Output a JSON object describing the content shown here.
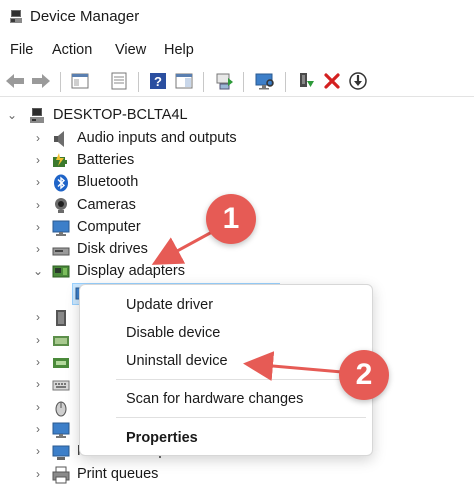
{
  "window": {
    "title": "Device Manager"
  },
  "menu": [
    {
      "id": "file",
      "label": "File"
    },
    {
      "id": "action",
      "label": "Action"
    },
    {
      "id": "view",
      "label": "View"
    },
    {
      "id": "help",
      "label": "Help"
    }
  ],
  "toolbar": [
    {
      "name": "back-icon"
    },
    {
      "name": "forward-icon"
    },
    {
      "name": "properties-icon"
    },
    {
      "name": "show-hide-console-tree-icon"
    },
    {
      "name": "help-icon"
    },
    {
      "name": "action-pane-icon"
    },
    {
      "name": "update-driver-icon"
    },
    {
      "name": "scan-hardware-icon"
    },
    {
      "name": "enable-device-icon"
    },
    {
      "name": "uninstall-icon"
    },
    {
      "name": "disable-device-icon"
    }
  ],
  "tree": {
    "root": "DESKTOP-BCLTA4L",
    "items": [
      {
        "label": "Audio inputs and outputs",
        "icon": "speaker-icon"
      },
      {
        "label": "Batteries",
        "icon": "battery-icon"
      },
      {
        "label": "Bluetooth",
        "icon": "bluetooth-icon"
      },
      {
        "label": "Cameras",
        "icon": "camera-icon"
      },
      {
        "label": "Computer",
        "icon": "monitor-icon"
      },
      {
        "label": "Disk drives",
        "icon": "disk-drive-icon"
      },
      {
        "label": "Display adapters",
        "icon": "display-adapter-icon"
      },
      {
        "label": "",
        "icon": "display-adapter-device-icon"
      },
      {
        "label": "",
        "icon": "firmware-icon"
      },
      {
        "label": "",
        "icon": "hid-icon"
      },
      {
        "label": "",
        "icon": "ide-icon"
      },
      {
        "label": "",
        "icon": "keyboard-icon"
      },
      {
        "label": "",
        "icon": "mouse-icon"
      },
      {
        "label": "",
        "icon": "monitors-icon"
      },
      {
        "label": "Network adapters",
        "icon": "network-adapter-icon"
      },
      {
        "label": "Print queues",
        "icon": "printer-icon"
      }
    ]
  },
  "context_menu": {
    "items": [
      "Update driver",
      "Disable device",
      "Uninstall device",
      "Scan for hardware changes"
    ],
    "properties": "Properties"
  },
  "callouts": [
    "1",
    "2"
  ],
  "colors": {
    "callout": "#e65b55",
    "selection": "#cce8ff"
  }
}
